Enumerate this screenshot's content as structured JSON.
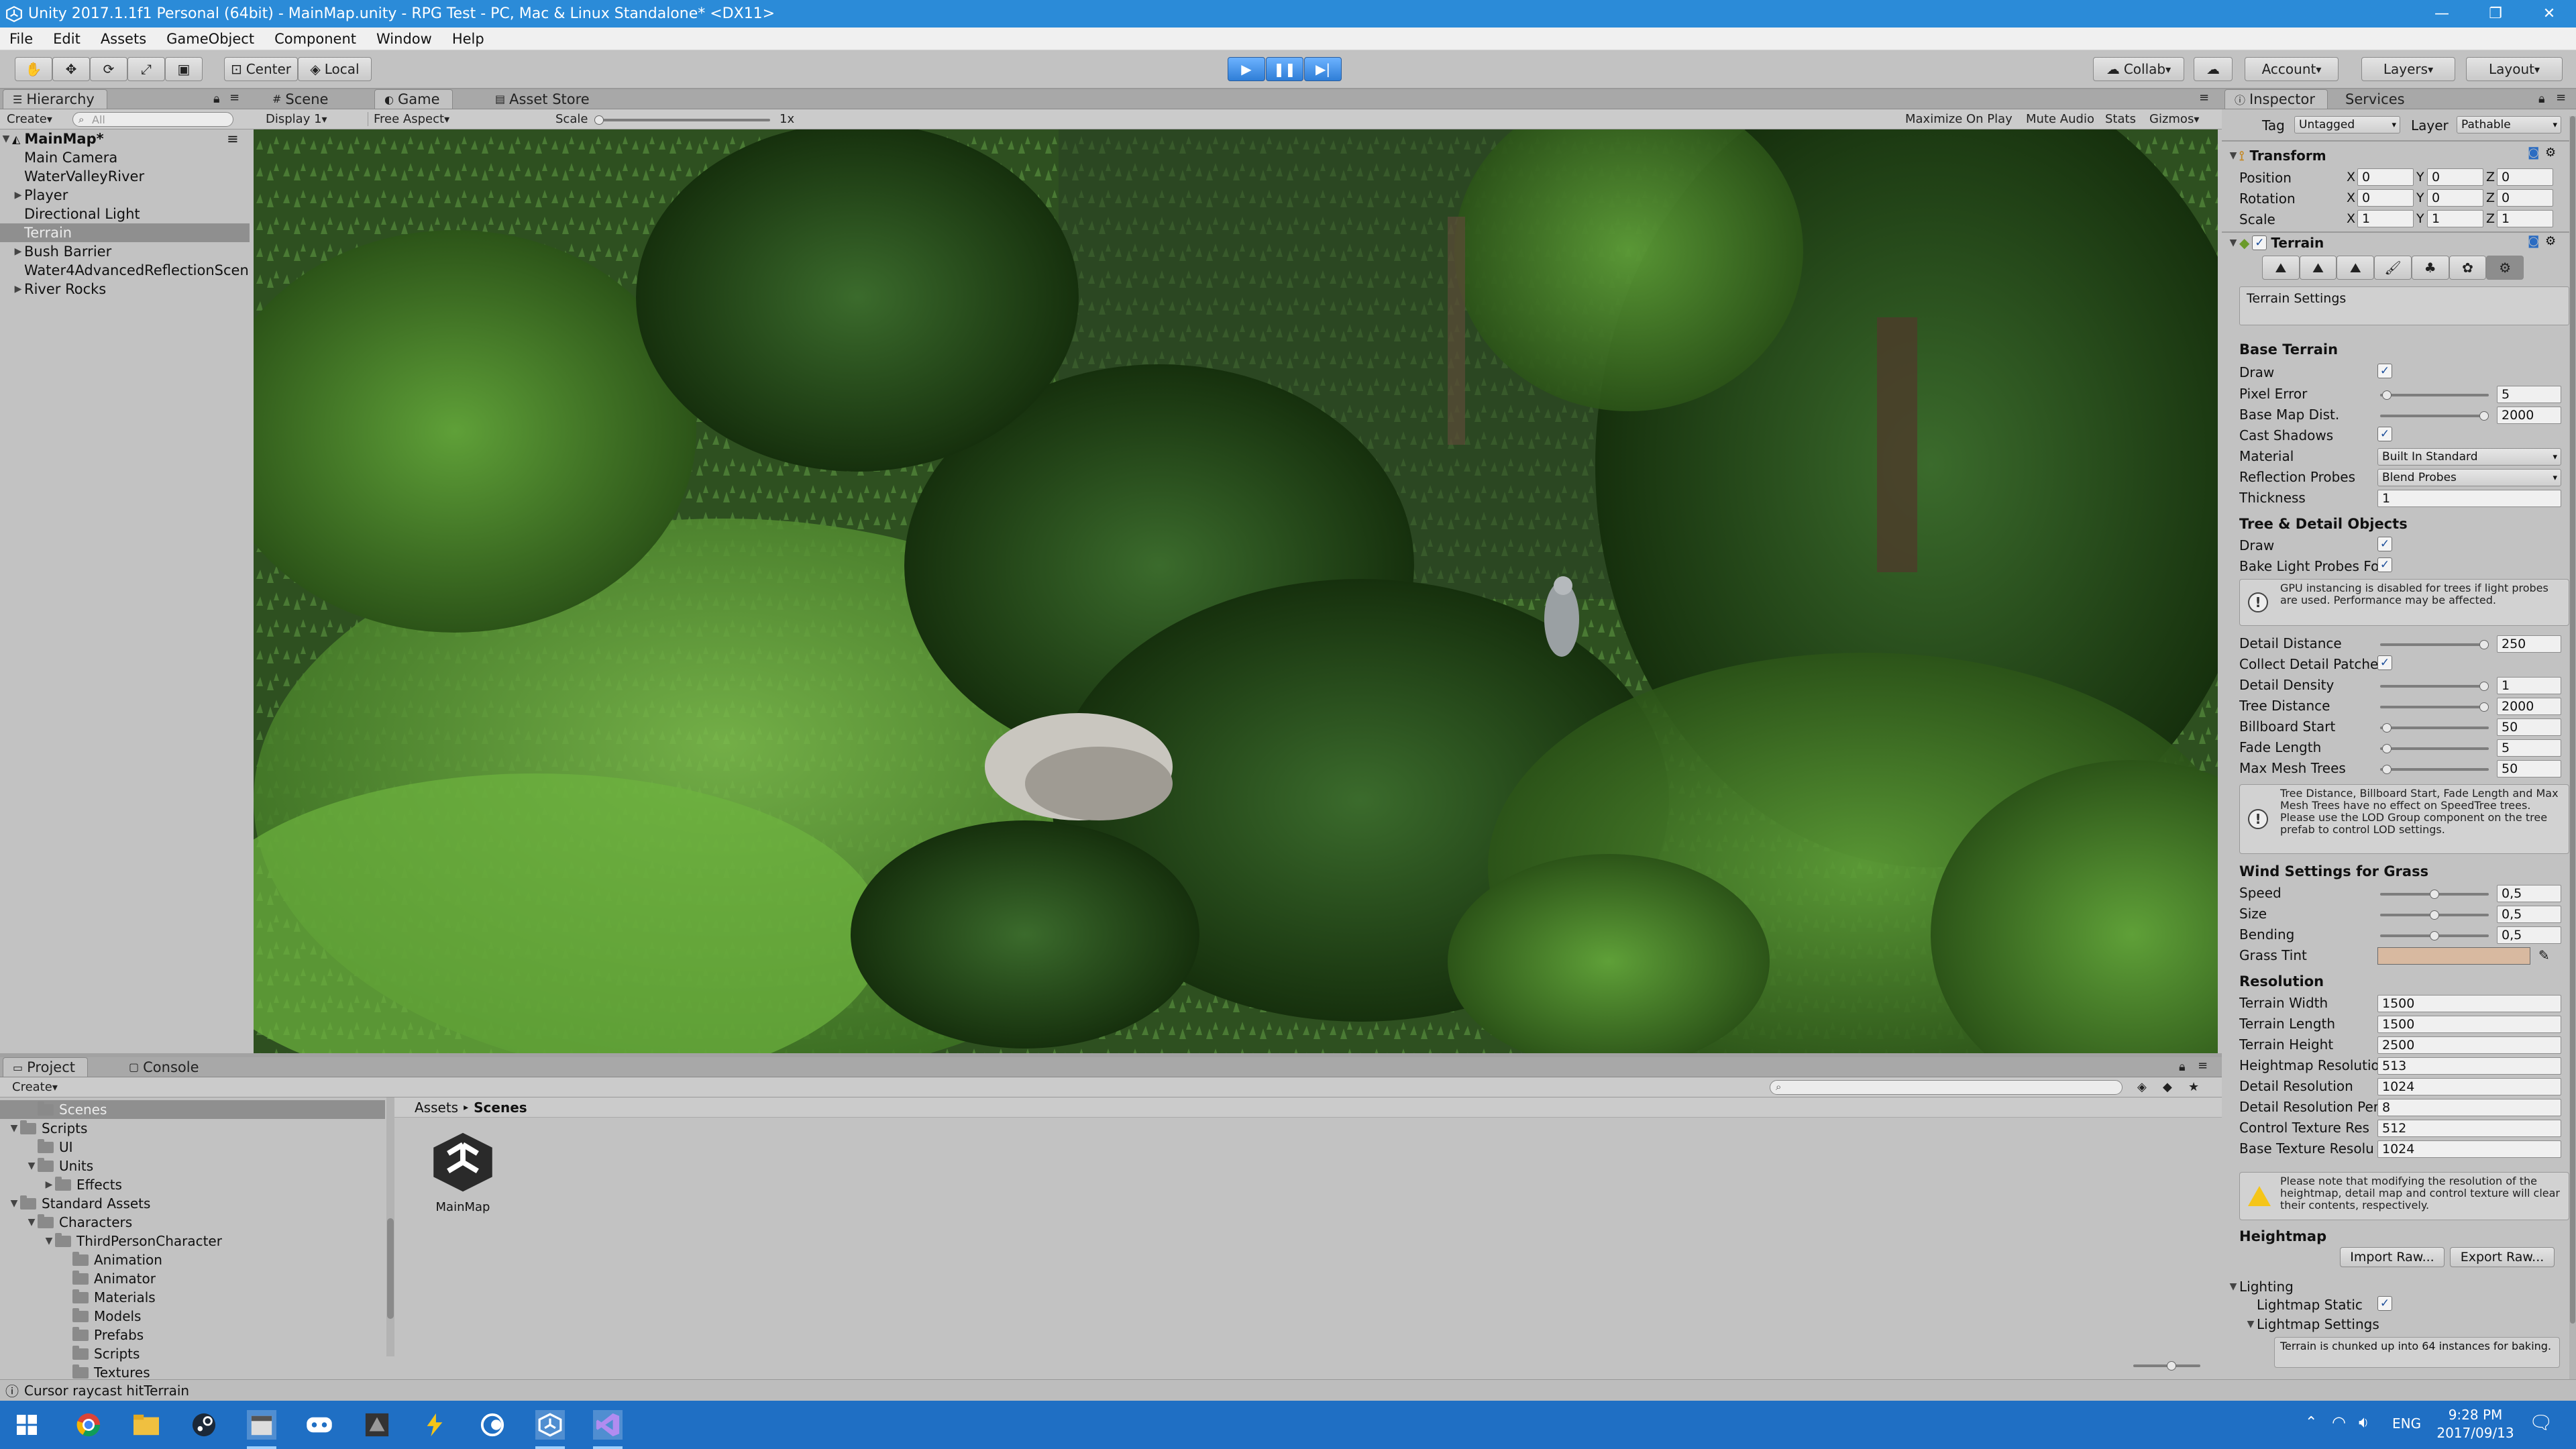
{
  "window": {
    "title": "Unity 2017.1.1f1 Personal (64bit) - MainMap.unity - RPG Test - PC, Mac & Linux Standalone* <DX11>",
    "controls": [
      "—",
      "❐",
      "✕"
    ]
  },
  "menubar": [
    "File",
    "Edit",
    "Assets",
    "GameObject",
    "Component",
    "Window",
    "Help"
  ],
  "toolbar": {
    "pivot": "Center",
    "space": "Local",
    "collab": "Collab",
    "account": "Account",
    "layers": "Layers",
    "layout": "Layout"
  },
  "hierarchy": {
    "tab": "Hierarchy",
    "create": "Create",
    "search_placeholder": "All",
    "scene": "MainMap*",
    "items": [
      {
        "label": "Main Camera",
        "indent": 1,
        "expand": false,
        "selected": false
      },
      {
        "label": "WaterValleyRiver",
        "indent": 1,
        "expand": false,
        "selected": false
      },
      {
        "label": "Player",
        "indent": 1,
        "expand": true,
        "selected": false
      },
      {
        "label": "Directional Light",
        "indent": 1,
        "expand": false,
        "selected": false
      },
      {
        "label": "Terrain",
        "indent": 1,
        "expand": false,
        "selected": true
      },
      {
        "label": "Bush Barrier",
        "indent": 1,
        "expand": true,
        "selected": false
      },
      {
        "label": "Water4AdvancedReflectionScen",
        "indent": 1,
        "expand": false,
        "selected": false
      },
      {
        "label": "River Rocks",
        "indent": 1,
        "expand": true,
        "selected": false
      }
    ]
  },
  "views": {
    "tabs": [
      "Scene",
      "Game",
      "Asset Store"
    ],
    "active_tab": "Game",
    "display": "Display 1",
    "aspect": "Free Aspect",
    "scale_label": "Scale",
    "scale_value": "1x",
    "toggles": [
      "Maximize On Play",
      "Mute Audio",
      "Stats",
      "Gizmos"
    ]
  },
  "inspector": {
    "tabs": [
      "Inspector",
      "Services"
    ],
    "tag_label": "Tag",
    "tag_value": "Untagged",
    "layer_label": "Layer",
    "layer_value": "Pathable",
    "transform": {
      "title": "Transform",
      "rows": [
        {
          "label": "Position",
          "x": "0",
          "y": "0",
          "z": "0"
        },
        {
          "label": "Rotation",
          "x": "0",
          "y": "0",
          "z": "0"
        },
        {
          "label": "Scale",
          "x": "1",
          "y": "1",
          "z": "1"
        }
      ]
    },
    "terrain": {
      "title": "Terrain",
      "settings_label": "Terrain Settings",
      "base_header": "Base Terrain",
      "draw_label": "Draw",
      "pixel_error": {
        "label": "Pixel Error",
        "value": "5",
        "fraction": 0.02
      },
      "base_map_dist": {
        "label": "Base Map Dist.",
        "value": "2000",
        "fraction": 1.0
      },
      "cast_shadows_label": "Cast Shadows",
      "material": {
        "label": "Material",
        "value": "Built In Standard"
      },
      "reflection_probes": {
        "label": "Reflection Probes",
        "value": "Blend Probes"
      },
      "thickness": {
        "label": "Thickness",
        "value": "1"
      },
      "tree_header": "Tree & Detail Objects",
      "tree_draw_label": "Draw",
      "bake_label": "Bake Light Probes Fo",
      "gpu_warning": "GPU instancing is disabled for trees if light probes are used. Performance may be affected.",
      "detail_distance": {
        "label": "Detail Distance",
        "value": "250",
        "fraction": 1.0
      },
      "collect_label": "Collect Detail Patche",
      "detail_density": {
        "label": "Detail Density",
        "value": "1",
        "fraction": 1.0
      },
      "tree_distance": {
        "label": "Tree Distance",
        "value": "2000",
        "fraction": 1.0
      },
      "billboard_start": {
        "label": "Billboard Start",
        "value": "50",
        "fraction": 0.02
      },
      "fade_length": {
        "label": "Fade Length",
        "value": "5",
        "fraction": 0.02
      },
      "max_mesh_trees": {
        "label": "Max Mesh Trees",
        "value": "50",
        "fraction": 0.02
      },
      "tree_info": "Tree Distance, Billboard Start, Fade Length and Max Mesh Trees have no effect on SpeedTree trees. Please use the LOD Group component on the tree prefab to control LOD settings.",
      "wind_header": "Wind Settings for Grass",
      "speed": {
        "label": "Speed",
        "value": "0,5",
        "fraction": 0.5
      },
      "size": {
        "label": "Size",
        "value": "0,5",
        "fraction": 0.5
      },
      "bending": {
        "label": "Bending",
        "value": "0,5",
        "fraction": 0.5
      },
      "grass_tint_label": "Grass Tint",
      "grass_tint_color": "#d8b9a0",
      "resolution_header": "Resolution",
      "resolution_rows": [
        {
          "label": "Terrain Width",
          "value": "1500"
        },
        {
          "label": "Terrain Length",
          "value": "1500"
        },
        {
          "label": "Terrain Height",
          "value": "2500"
        },
        {
          "label": "Heightmap Resolutio",
          "value": "513"
        },
        {
          "label": "Detail Resolution",
          "value": "1024"
        },
        {
          "label": "Detail Resolution Per",
          "value": "8"
        },
        {
          "label": "Control Texture Res",
          "value": "512"
        },
        {
          "label": "Base Texture Resolu",
          "value": "1024"
        }
      ],
      "resolution_warning": "Please note that modifying the resolution of the heightmap, detail map and control texture will clear their contents, respectively.",
      "heightmap_header": "Heightmap",
      "import_raw": "Import Raw...",
      "export_raw": "Export Raw...",
      "lighting_label": "Lighting",
      "lightmap_static_label": "Lightmap Static",
      "lightmap_settings_label": "Lightmap Settings",
      "lightmap_info": "Terrain is chunked up into 64 instances for baking."
    }
  },
  "project": {
    "tabs": [
      "Project",
      "Console"
    ],
    "create": "Create",
    "breadcrumb": [
      "Assets",
      "Scenes"
    ],
    "tree": [
      {
        "label": "Scenes",
        "indent": 1,
        "expand": "none",
        "selected": true
      },
      {
        "label": "Scripts",
        "indent": 0,
        "expand": "open",
        "selected": false
      },
      {
        "label": "UI",
        "indent": 1,
        "expand": "none",
        "selected": false
      },
      {
        "label": "Units",
        "indent": 1,
        "expand": "open",
        "selected": false
      },
      {
        "label": "Effects",
        "indent": 2,
        "expand": "closed",
        "selected": false
      },
      {
        "label": "Standard Assets",
        "indent": 0,
        "expand": "open",
        "selected": false
      },
      {
        "label": "Characters",
        "indent": 1,
        "expand": "open",
        "selected": false
      },
      {
        "label": "ThirdPersonCharacter",
        "indent": 2,
        "expand": "open",
        "selected": false
      },
      {
        "label": "Animation",
        "indent": 3,
        "expand": "none",
        "selected": false
      },
      {
        "label": "Animator",
        "indent": 3,
        "expand": "none",
        "selected": false
      },
      {
        "label": "Materials",
        "indent": 3,
        "expand": "none",
        "selected": false
      },
      {
        "label": "Models",
        "indent": 3,
        "expand": "none",
        "selected": false
      },
      {
        "label": "Prefabs",
        "indent": 3,
        "expand": "none",
        "selected": false
      },
      {
        "label": "Scripts",
        "indent": 3,
        "expand": "none",
        "selected": false
      },
      {
        "label": "Textures",
        "indent": 3,
        "expand": "none",
        "selected": false
      }
    ],
    "asset": "MainMap"
  },
  "statusbar": "Cursor raycast hitTerrain",
  "taskbar": {
    "apps": [
      "chrome",
      "explorer",
      "steam",
      "unity-hub",
      "app5",
      "app6",
      "app7",
      "app8",
      "unity",
      "visual-studio"
    ],
    "tray_lang": "ENG",
    "time": "9:28 PM",
    "date": "2017/09/13"
  },
  "colors": {
    "accent": "#2b8bd8",
    "taskbar": "#1f6fc4",
    "panel": "#c2c2c2",
    "selection": "#8f8f8f"
  }
}
